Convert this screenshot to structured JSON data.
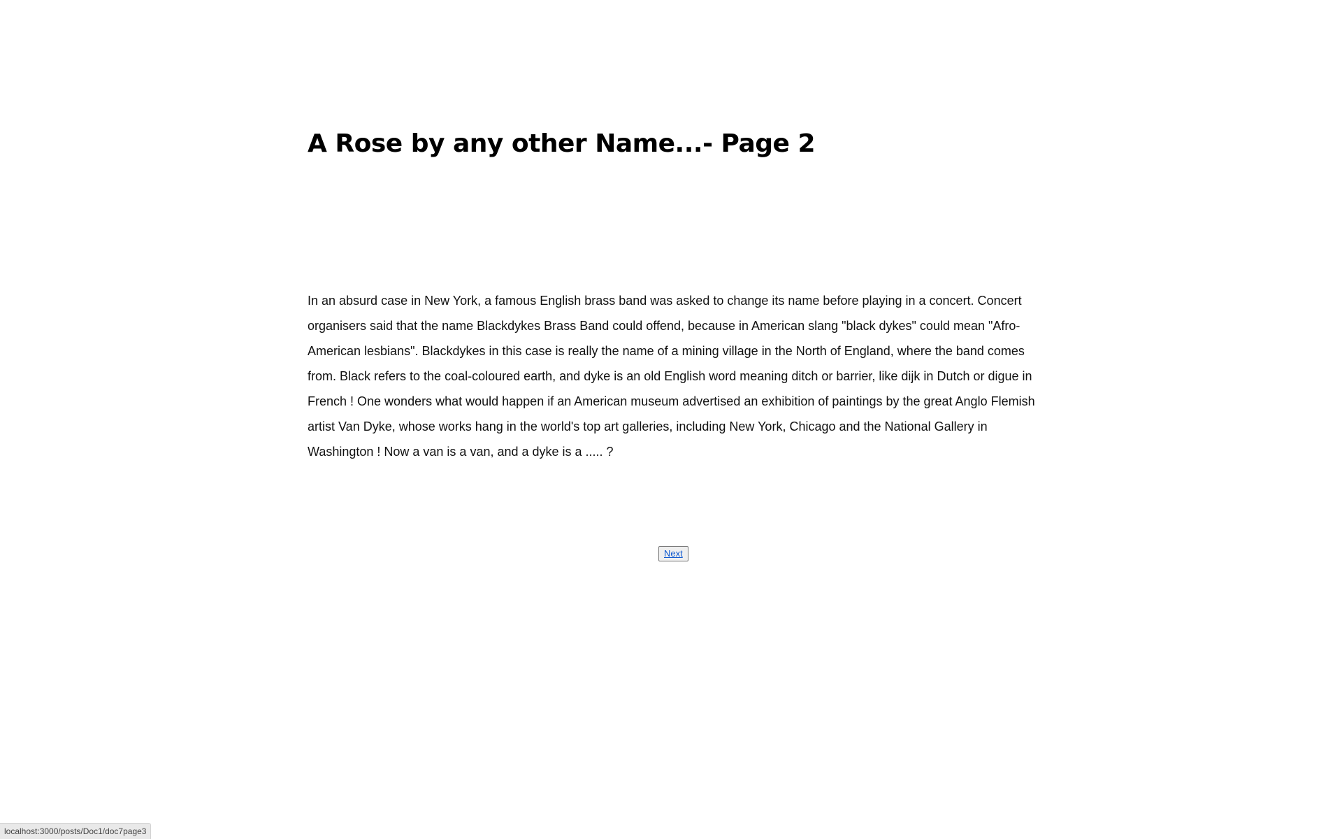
{
  "page": {
    "title": "A Rose by any other Name...- Page 2",
    "body": "In an absurd case in New York, a famous English brass band was asked to change its name before playing in a concert. Concert organisers said that the name Blackdykes Brass Band could offend, because in American slang \"black dykes\" could mean \"Afro-American lesbians\". Blackdykes in this case is really the name of a mining village in the North of England, where the band comes from. Black refers to the coal-coloured earth, and dyke is an old English word meaning ditch or barrier, like dijk in Dutch or digue in French ! One wonders what would happen if an American museum advertised an exhibition of paintings by the great Anglo Flemish artist Van Dyke, whose works hang in the world's top art galleries, including New York, Chicago and the National Gallery in Washington ! Now a van is a van, and a dyke is a ..... ?",
    "next_label": "Next"
  },
  "status_bar": {
    "url": "localhost:3000/posts/Doc1/doc7page3"
  },
  "colors": {
    "link": "#0b57d0",
    "text": "#111111",
    "background": "#ffffff"
  }
}
